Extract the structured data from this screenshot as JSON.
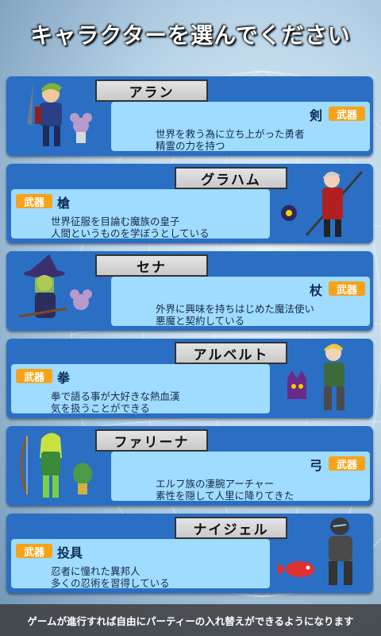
{
  "title": "キャラクターを選んでください",
  "weapon_label": "武器",
  "characters": [
    {
      "name": "アラン",
      "weapon": "剣",
      "line1": "世界を救う為に立ち上がった勇者",
      "line2": "精霊の力を持つ"
    },
    {
      "name": "グラハム",
      "weapon": "槍",
      "line1": "世界征服を目論む魔族の皇子",
      "line2": "人間というものを学ぼうとしている"
    },
    {
      "name": "セナ",
      "weapon": "杖",
      "line1": "外界に興味を持ちはじめた魔法使い",
      "line2": "悪魔と契約している"
    },
    {
      "name": "アルベルト",
      "weapon": "拳",
      "line1": "拳で語る事が大好きな熱血漢",
      "line2": "気を扱うことができる"
    },
    {
      "name": "ファリーナ",
      "weapon": "弓",
      "line1": "エルフ族の凄腕アーチャー",
      "line2": "素性を隠して人里に降りてきた"
    },
    {
      "name": "ナイジェル",
      "weapon": "投具",
      "line1": "忍者に憧れた異邦人",
      "line2": "多くの忍術を習得している"
    }
  ],
  "footer": "ゲームが進行すれば自由にパーティーの入れ替えができるようになります"
}
